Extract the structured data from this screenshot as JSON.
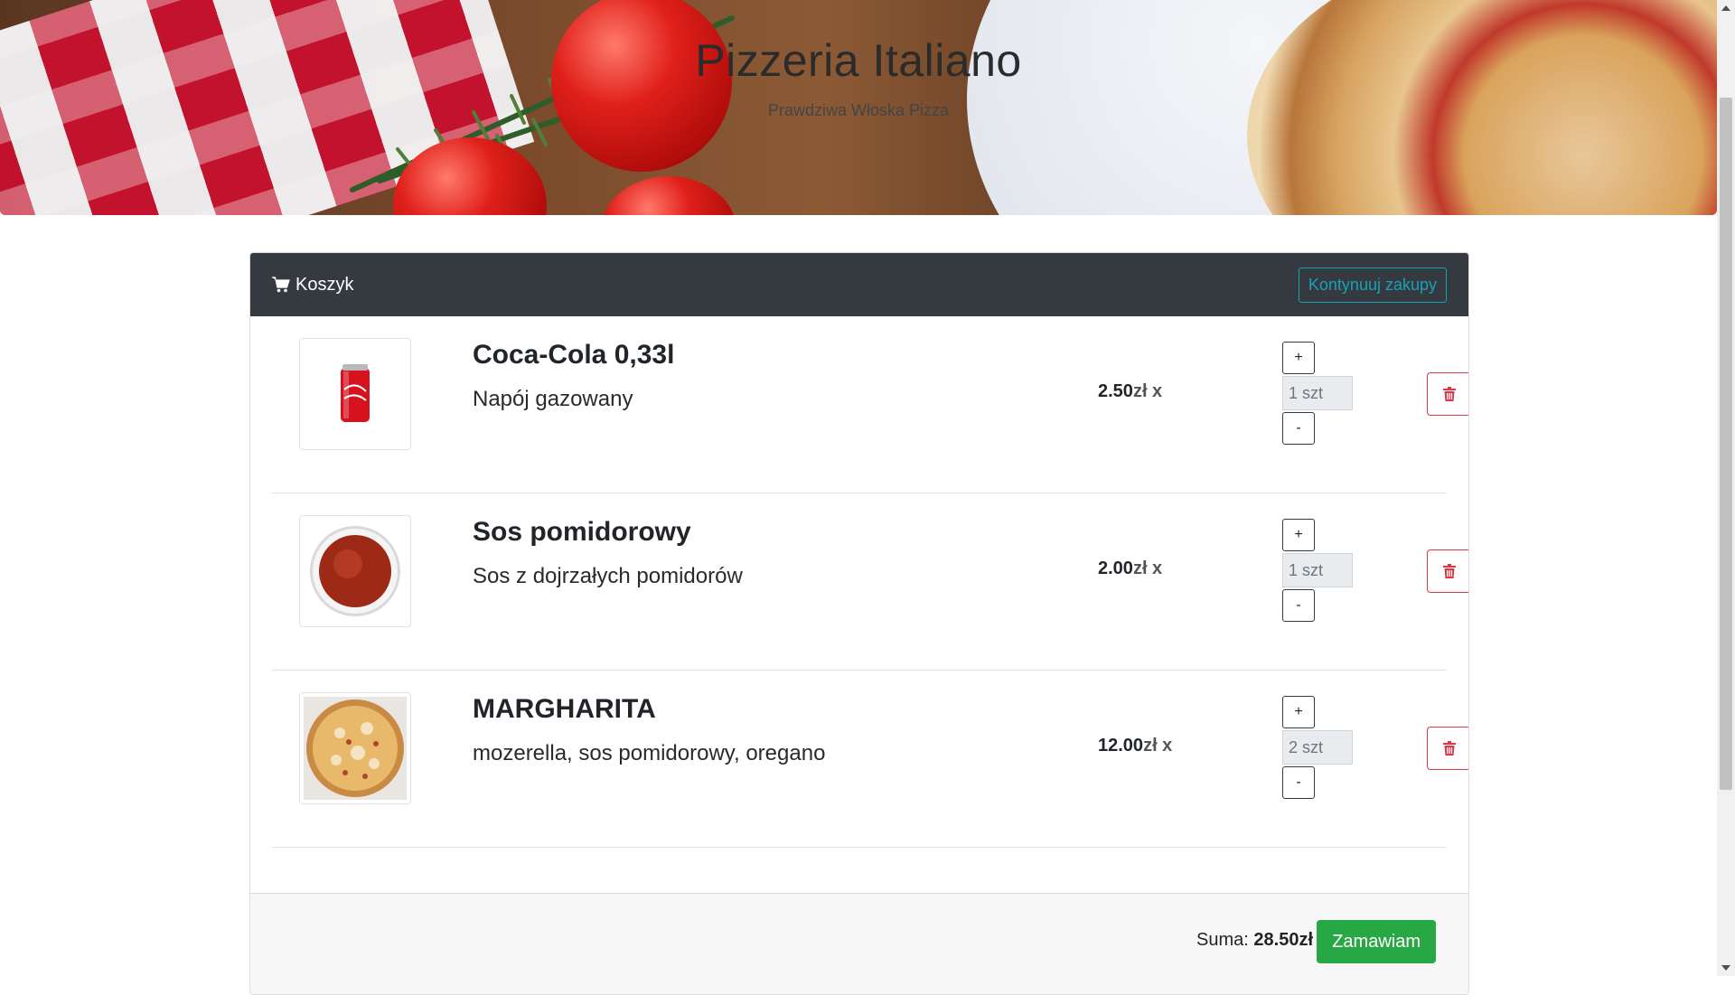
{
  "hero": {
    "title": "Pizzeria Italiano",
    "subtitle": "Prawdziwa Włoska Pizza"
  },
  "cart": {
    "title": "Koszyk",
    "title_icon": "shopping-cart-icon",
    "continue_label": "Kontynuuj zakupy",
    "items": [
      {
        "name": "Coca-Cola 0,33l",
        "description": "Napój gazowany",
        "price": "2.50",
        "currency": "zł x",
        "quantity": "1 szt",
        "image_icon": "cola-can-image"
      },
      {
        "name": "Sos pomidorowy",
        "description": "Sos z dojrzałych pomidorów",
        "price": "2.00",
        "currency": "zł x",
        "quantity": "1 szt",
        "image_icon": "sauce-bowl-image"
      },
      {
        "name": "MARGHARITA",
        "description": "mozerella, sos pomidorowy, oregano",
        "price": "12.00",
        "currency": "zł x",
        "quantity": "2 szt",
        "image_icon": "pizza-image"
      }
    ],
    "plus_label": "+",
    "minus_label": "-",
    "delete_icon": "trash-icon"
  },
  "footer": {
    "sum_label": "Suma:",
    "sum_value": "28.50zł",
    "order_label": "Zamawiam"
  },
  "colors": {
    "header_bg": "#343a40",
    "info": "#17a2b8",
    "danger": "#dc3545",
    "success": "#28a745"
  }
}
